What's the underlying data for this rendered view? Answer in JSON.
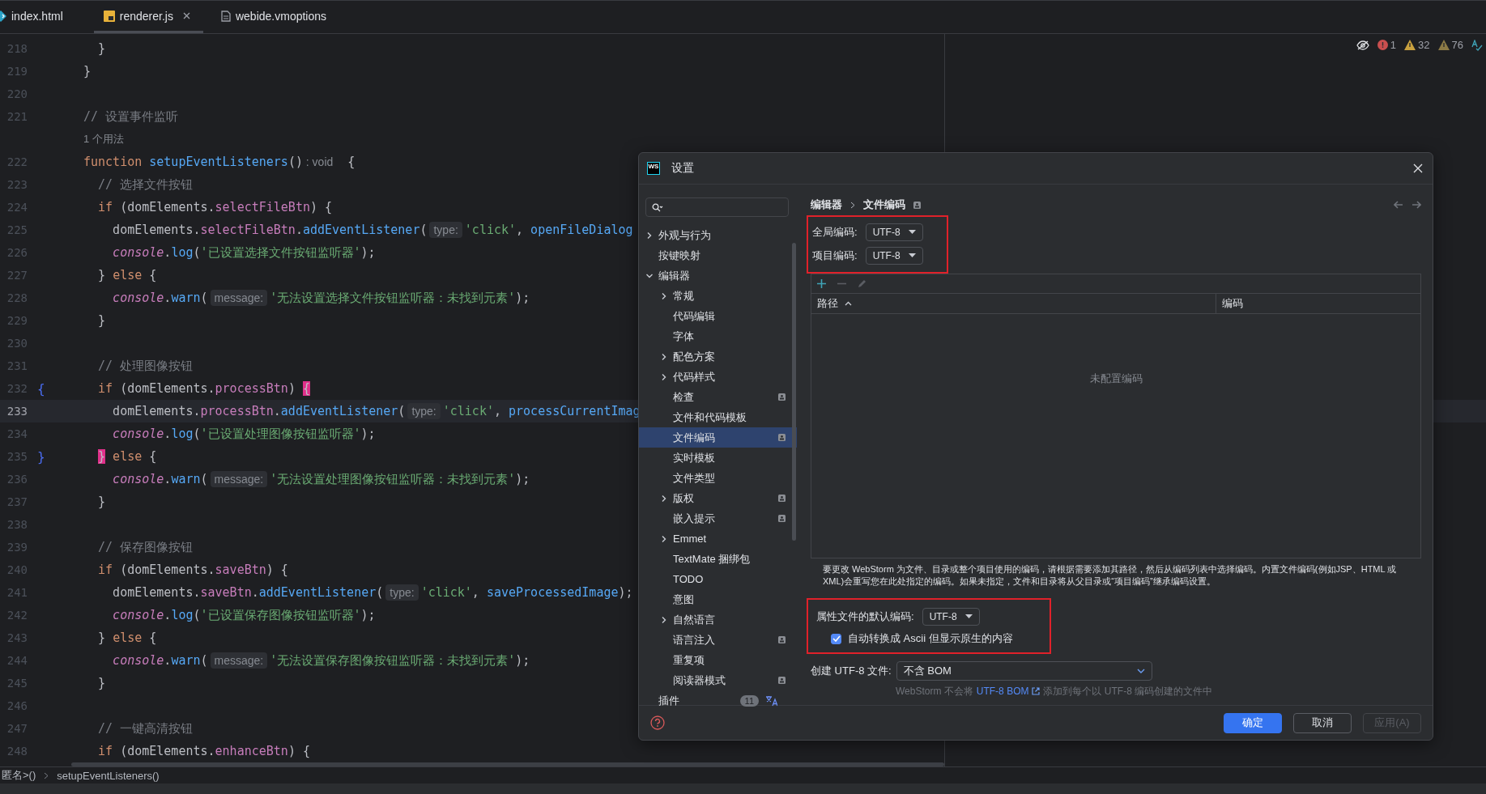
{
  "tabs": [
    {
      "label": "index.html",
      "kind": "html",
      "selected": false,
      "closable": false
    },
    {
      "label": "renderer.js",
      "kind": "js",
      "selected": true,
      "closable": true
    },
    {
      "label": "webide.vmoptions",
      "kind": "file",
      "selected": false,
      "closable": false
    }
  ],
  "inspections": {
    "errors": "1",
    "warnings": "32",
    "weak_warnings": "76"
  },
  "code": [
    {
      "num": "218",
      "kind": "code",
      "current": false,
      "tokens": [
        {
          "text": "  }",
          "kind": "plain"
        }
      ]
    },
    {
      "num": "219",
      "kind": "code",
      "current": false,
      "tokens": [
        {
          "text": "}",
          "kind": "plain"
        }
      ]
    },
    {
      "num": "220",
      "kind": "code",
      "current": false
    },
    {
      "num": "221",
      "kind": "code",
      "current": false,
      "tokens": [
        {
          "text": "// 设置事件监听",
          "kind": "comment"
        }
      ]
    },
    {
      "kind": "usage",
      "text": "1 个用法"
    },
    {
      "num": "222",
      "kind": "code",
      "current": false,
      "tokens": [
        {
          "text": "function",
          "kind": "kw"
        },
        {
          "text": " setupEventListeners",
          "kind": "method"
        },
        {
          "text": "()",
          "kind": "plain"
        },
        {
          "text": " : void",
          "kind": "type"
        },
        {
          "text": "  {",
          "kind": "plain"
        }
      ]
    },
    {
      "num": "223",
      "kind": "code",
      "current": false,
      "tokens": [
        {
          "text": "  // 选择文件按钮",
          "kind": "comment"
        }
      ]
    },
    {
      "num": "224",
      "kind": "code",
      "current": false,
      "tokens": [
        {
          "text": "  if",
          "kind": "kw"
        },
        {
          "text": " (domElements.",
          "kind": "plain"
        },
        {
          "text": "selectFileBtn",
          "kind": "prop"
        },
        {
          "text": ") {",
          "kind": "plain"
        }
      ]
    },
    {
      "num": "225",
      "kind": "code",
      "current": false,
      "tokens": [
        {
          "text": "    domElements.",
          "kind": "plain"
        },
        {
          "text": "selectFileBtn",
          "kind": "prop"
        },
        {
          "text": ".",
          "kind": "plain"
        },
        {
          "text": "addEventListener",
          "kind": "method"
        },
        {
          "text": "(",
          "kind": "plain"
        },
        {
          "text": "type:",
          "kind": "hint"
        },
        {
          "text": "'click'",
          "kind": "str"
        },
        {
          "text": ", ",
          "kind": "plain"
        },
        {
          "text": "openFileDialog",
          "kind": "method"
        }
      ]
    },
    {
      "num": "226",
      "kind": "code",
      "current": false,
      "tokens": [
        {
          "text": "    console",
          "kind": "obj"
        },
        {
          "text": ".",
          "kind": "plain"
        },
        {
          "text": "log",
          "kind": "method"
        },
        {
          "text": "(",
          "kind": "plain"
        },
        {
          "text": "'已设置选择文件按钮监听器'",
          "kind": "str"
        },
        {
          "text": ");",
          "kind": "plain"
        }
      ]
    },
    {
      "num": "227",
      "kind": "code",
      "current": false,
      "tokens": [
        {
          "text": "  } ",
          "kind": "plain"
        },
        {
          "text": "else",
          "kind": "kw"
        },
        {
          "text": " {",
          "kind": "plain"
        }
      ]
    },
    {
      "num": "228",
      "kind": "code",
      "current": false,
      "tokens": [
        {
          "text": "    console",
          "kind": "obj"
        },
        {
          "text": ".",
          "kind": "plain"
        },
        {
          "text": "warn",
          "kind": "method"
        },
        {
          "text": "(",
          "kind": "plain"
        },
        {
          "text": "message:",
          "kind": "hint"
        },
        {
          "text": "'无法设置选择文件按钮监听器：未找到元素'",
          "kind": "str"
        },
        {
          "text": ");",
          "kind": "plain"
        }
      ]
    },
    {
      "num": "229",
      "kind": "code",
      "current": false,
      "tokens": [
        {
          "text": "  }",
          "kind": "plain"
        }
      ]
    },
    {
      "num": "230",
      "kind": "code",
      "current": false
    },
    {
      "num": "231",
      "kind": "code",
      "current": false,
      "tokens": [
        {
          "text": "  // 处理图像按钮",
          "kind": "comment"
        }
      ]
    },
    {
      "num": "232",
      "kind": "code",
      "current": false,
      "gutter": "{",
      "tokens": [
        {
          "text": "  if",
          "kind": "kw"
        },
        {
          "text": " (domElements.",
          "kind": "plain"
        },
        {
          "text": "processBtn",
          "kind": "prop"
        },
        {
          "text": ") ",
          "kind": "plain"
        },
        {
          "text": "{",
          "kind": "match"
        }
      ]
    },
    {
      "num": "233",
      "kind": "code",
      "current": true,
      "tokens": [
        {
          "text": "    domElements.",
          "kind": "plain"
        },
        {
          "text": "processBtn",
          "kind": "prop"
        },
        {
          "text": ".",
          "kind": "plain"
        },
        {
          "text": "addEventListener",
          "kind": "method"
        },
        {
          "text": "(",
          "kind": "plain"
        },
        {
          "text": "type:",
          "kind": "hint"
        },
        {
          "text": "'click'",
          "kind": "str"
        },
        {
          "text": ", ",
          "kind": "plain"
        },
        {
          "text": "processCurrentImag",
          "kind": "method"
        }
      ]
    },
    {
      "num": "234",
      "kind": "code",
      "current": false,
      "tokens": [
        {
          "text": "    console",
          "kind": "obj"
        },
        {
          "text": ".",
          "kind": "plain"
        },
        {
          "text": "log",
          "kind": "method"
        },
        {
          "text": "(",
          "kind": "plain"
        },
        {
          "text": "'已设置处理图像按钮监听器'",
          "kind": "str"
        },
        {
          "text": ");",
          "kind": "plain"
        }
      ]
    },
    {
      "num": "235",
      "kind": "code",
      "current": false,
      "gutter": "}",
      "tokens": [
        {
          "text": "  }",
          "kind": "match"
        },
        {
          "text": " else",
          "kind": "kw"
        },
        {
          "text": " {",
          "kind": "plain"
        }
      ]
    },
    {
      "num": "236",
      "kind": "code",
      "current": false,
      "tokens": [
        {
          "text": "    console",
          "kind": "obj"
        },
        {
          "text": ".",
          "kind": "plain"
        },
        {
          "text": "warn",
          "kind": "method"
        },
        {
          "text": "(",
          "kind": "plain"
        },
        {
          "text": "message:",
          "kind": "hint"
        },
        {
          "text": "'无法设置处理图像按钮监听器：未找到元素'",
          "kind": "str"
        },
        {
          "text": ");",
          "kind": "plain"
        }
      ]
    },
    {
      "num": "237",
      "kind": "code",
      "current": false,
      "tokens": [
        {
          "text": "  }",
          "kind": "plain"
        }
      ]
    },
    {
      "num": "238",
      "kind": "code",
      "current": false
    },
    {
      "num": "239",
      "kind": "code",
      "current": false,
      "tokens": [
        {
          "text": "  // 保存图像按钮",
          "kind": "comment"
        }
      ]
    },
    {
      "num": "240",
      "kind": "code",
      "current": false,
      "tokens": [
        {
          "text": "  if",
          "kind": "kw"
        },
        {
          "text": " (domElements.",
          "kind": "plain"
        },
        {
          "text": "saveBtn",
          "kind": "prop"
        },
        {
          "text": ") {",
          "kind": "plain"
        }
      ]
    },
    {
      "num": "241",
      "kind": "code",
      "current": false,
      "tokens": [
        {
          "text": "    domElements.",
          "kind": "plain"
        },
        {
          "text": "saveBtn",
          "kind": "prop"
        },
        {
          "text": ".",
          "kind": "plain"
        },
        {
          "text": "addEventListener",
          "kind": "method"
        },
        {
          "text": "(",
          "kind": "plain"
        },
        {
          "text": "type:",
          "kind": "hint"
        },
        {
          "text": "'click'",
          "kind": "str"
        },
        {
          "text": ", ",
          "kind": "plain"
        },
        {
          "text": "saveProcessedImage",
          "kind": "method"
        },
        {
          "text": ");",
          "kind": "plain"
        }
      ]
    },
    {
      "num": "242",
      "kind": "code",
      "current": false,
      "tokens": [
        {
          "text": "    console",
          "kind": "obj"
        },
        {
          "text": ".",
          "kind": "plain"
        },
        {
          "text": "log",
          "kind": "method"
        },
        {
          "text": "(",
          "kind": "plain"
        },
        {
          "text": "'已设置保存图像按钮监听器'",
          "kind": "str"
        },
        {
          "text": ");",
          "kind": "plain"
        }
      ]
    },
    {
      "num": "243",
      "kind": "code",
      "current": false,
      "tokens": [
        {
          "text": "  } ",
          "kind": "plain"
        },
        {
          "text": "else",
          "kind": "kw"
        },
        {
          "text": " {",
          "kind": "plain"
        }
      ]
    },
    {
      "num": "244",
      "kind": "code",
      "current": false,
      "tokens": [
        {
          "text": "    console",
          "kind": "obj"
        },
        {
          "text": ".",
          "kind": "plain"
        },
        {
          "text": "warn",
          "kind": "method"
        },
        {
          "text": "(",
          "kind": "plain"
        },
        {
          "text": "message:",
          "kind": "hint"
        },
        {
          "text": "'无法设置保存图像按钮监听器：未找到元素'",
          "kind": "str"
        },
        {
          "text": ");",
          "kind": "plain"
        }
      ]
    },
    {
      "num": "245",
      "kind": "code",
      "current": false,
      "tokens": [
        {
          "text": "  }",
          "kind": "plain"
        }
      ]
    },
    {
      "num": "246",
      "kind": "code",
      "current": false
    },
    {
      "num": "247",
      "kind": "code",
      "current": false,
      "tokens": [
        {
          "text": "  // 一键高清按钮",
          "kind": "comment"
        }
      ]
    },
    {
      "num": "248",
      "kind": "code",
      "current": false,
      "tokens": [
        {
          "text": "  if",
          "kind": "kw"
        },
        {
          "text": " (domElements.",
          "kind": "plain"
        },
        {
          "text": "enhanceBtn",
          "kind": "prop"
        },
        {
          "text": ") {",
          "kind": "plain"
        }
      ]
    }
  ],
  "breadcrumbs": [
    "匿名>()",
    "setupEventListeners()"
  ],
  "dialog": {
    "logo": "WS",
    "title": "设置",
    "sidebar": {
      "items": [
        {
          "label": "外观与行为",
          "kind": "folder",
          "expanded": false,
          "selected": false,
          "project_scope": false
        },
        {
          "label": "按键映射",
          "kind": "page",
          "selected": false,
          "project_scope": false
        },
        {
          "label": "编辑器",
          "kind": "folder",
          "expanded": true,
          "selected": false,
          "project_scope": false,
          "children": [
            {
              "label": "常规",
              "kind": "folder",
              "expanded": false,
              "selected": false,
              "project_scope": false
            },
            {
              "label": "代码编辑",
              "kind": "page",
              "selected": false,
              "project_scope": false
            },
            {
              "label": "字体",
              "kind": "page",
              "selected": false,
              "project_scope": false
            },
            {
              "label": "配色方案",
              "kind": "folder",
              "expanded": false,
              "selected": false,
              "project_scope": false
            },
            {
              "label": "代码样式",
              "kind": "folder",
              "expanded": false,
              "selected": false,
              "project_scope": false
            },
            {
              "label": "检查",
              "kind": "page",
              "selected": false,
              "project_scope": true
            },
            {
              "label": "文件和代码模板",
              "kind": "page",
              "selected": false,
              "project_scope": false
            },
            {
              "label": "文件编码",
              "kind": "page",
              "selected": true,
              "project_scope": true
            },
            {
              "label": "实时模板",
              "kind": "page",
              "selected": false,
              "project_scope": false
            },
            {
              "label": "文件类型",
              "kind": "page",
              "selected": false,
              "project_scope": false
            },
            {
              "label": "版权",
              "kind": "folder",
              "expanded": false,
              "selected": false,
              "project_scope": true
            },
            {
              "label": "嵌入提示",
              "kind": "page",
              "selected": false,
              "project_scope": true
            },
            {
              "label": "Emmet",
              "kind": "folder",
              "expanded": false,
              "selected": false,
              "project_scope": false
            },
            {
              "label": "TextMate 捆绑包",
              "kind": "page",
              "selected": false,
              "project_scope": false
            },
            {
              "label": "TODO",
              "kind": "page",
              "selected": false,
              "project_scope": false
            },
            {
              "label": "意图",
              "kind": "page",
              "selected": false,
              "project_scope": false
            },
            {
              "label": "自然语言",
              "kind": "folder",
              "expanded": false,
              "selected": false,
              "project_scope": false
            },
            {
              "label": "语言注入",
              "kind": "page",
              "selected": false,
              "project_scope": true
            },
            {
              "label": "重复项",
              "kind": "page",
              "selected": false,
              "project_scope": false
            },
            {
              "label": "阅读器模式",
              "kind": "page",
              "selected": false,
              "project_scope": true
            }
          ]
        },
        {
          "label": "插件",
          "kind": "page",
          "selected": false,
          "project_scope": false,
          "count": "11"
        }
      ]
    },
    "breadcrumb": [
      "编辑器",
      "文件编码"
    ],
    "encodings": {
      "highlighted": true,
      "fields": [
        {
          "label": "全局编码:",
          "value": "UTF-8"
        },
        {
          "label": "项目编码:",
          "value": "UTF-8"
        }
      ]
    },
    "table": {
      "toolbar": [
        {
          "kind": "add",
          "disabled": false
        },
        {
          "kind": "remove",
          "disabled": true
        },
        {
          "kind": "edit",
          "disabled": true
        }
      ],
      "columns": [
        {
          "label": "路径",
          "sorted": true
        },
        {
          "label": "编码",
          "sorted": false
        }
      ],
      "empty_text": "未配置编码"
    },
    "help_text": "要更改 WebStorm 为文件、目录或整个项目使用的编码，请根据需要添加其路径，然后从编码列表中选择编码。内置文件编码(例如JSP、HTML 或 XML)会重写您在此处指定的编码。如果未指定，文件和目录将从父目录或“项目编码”继承编码设置。",
    "properties": {
      "highlighted": true,
      "label": "属性文件的默认编码:",
      "value": "UTF-8",
      "checkbox": {
        "label": "自动转换成 Ascii 但显示原生的内容",
        "checked": true
      }
    },
    "bom": {
      "label": "创建 UTF-8 文件:",
      "value": "不含 BOM",
      "note_before": "WebStorm 不会将",
      "link": "UTF-8 BOM",
      "note_after": "添加到每个以 UTF-8 编码创建的文件中"
    },
    "buttons": [
      {
        "label": "确定",
        "kind": "primary",
        "disabled": false
      },
      {
        "label": "取消",
        "kind": "normal",
        "disabled": false
      },
      {
        "label": "应用(A)",
        "kind": "normal",
        "disabled": true
      }
    ]
  }
}
